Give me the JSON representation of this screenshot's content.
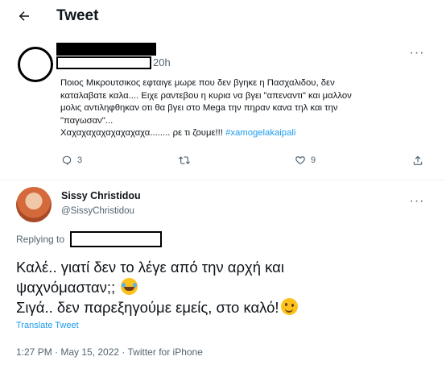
{
  "header": {
    "back_icon": "arrow-left-icon",
    "title": "Tweet"
  },
  "quoted_tweet": {
    "time_ago": "20h",
    "more_icon": "more-dots-icon",
    "lines": [
      "Ποιος Μικρουτσικος εφταιγε μωρε που δεν βγηκε η Πασχαλιδου, δεν",
      "καταλαβατε καλα.... Ειχε ραντεβου η κυρια να βγει \"απεναντι\" και μαλλον",
      "μολις αντιληφθηκαν οτι θα βγει στο Mega την πηραν κανα τηλ και την",
      "\"παγωσαν\"...",
      "Χαχαχαχαχαχαχαχαχα........ ρε τι ζουμε!!!"
    ],
    "hashtag": "#xamogelakaipali",
    "actions": {
      "reply_count": "3",
      "retweet_count": "",
      "like_count": "9"
    }
  },
  "reply_tweet": {
    "display_name": "Sissy Christidou",
    "handle": "@SissyChristidou",
    "replying_to_label": "Replying to",
    "body_lines": [
      "Καλέ.. γιατί δεν το λέγε από την αρχή και",
      "ψαχνόμασταν;; ",
      "Σιγά.. δεν παρεξηγούμε εμείς, στο καλό!"
    ],
    "emojis": [
      "face-with-tears-of-joy-icon",
      "winking-face-icon"
    ],
    "translate_label": "Translate Tweet",
    "meta": "1:27 PM · May 15, 2022 · Twitter for iPhone"
  },
  "colors": {
    "accent": "#1d9bf0",
    "secondary_text": "#536471",
    "primary_text": "#0f1419"
  }
}
